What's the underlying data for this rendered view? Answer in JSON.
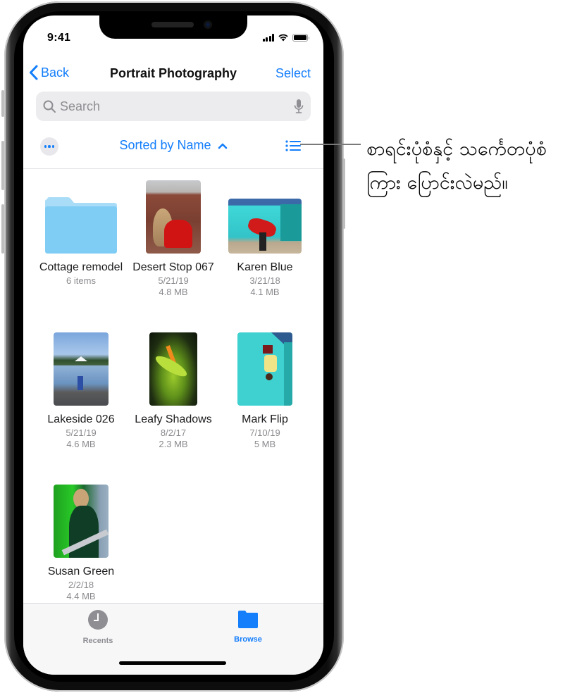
{
  "status_bar": {
    "time": "9:41"
  },
  "nav": {
    "back_label": "Back",
    "title": "Portrait Photography",
    "select_label": "Select"
  },
  "search": {
    "placeholder": "Search"
  },
  "sort_bar": {
    "sort_label": "Sorted by Name"
  },
  "items": [
    {
      "name": "Cottage remodel",
      "meta1": "6 items",
      "meta2": "",
      "kind": "folder"
    },
    {
      "name": "Desert Stop 067",
      "meta1": "5/21/19",
      "meta2": "4.8 MB",
      "kind": "photo"
    },
    {
      "name": "Karen Blue",
      "meta1": "3/21/18",
      "meta2": "4.1 MB",
      "kind": "photo"
    },
    {
      "name": "Lakeside 026",
      "meta1": "5/21/19",
      "meta2": "4.6 MB",
      "kind": "photo"
    },
    {
      "name": "Leafy Shadows",
      "meta1": "8/2/17",
      "meta2": "2.3 MB",
      "kind": "photo"
    },
    {
      "name": "Mark Flip",
      "meta1": "7/10/19",
      "meta2": "5 MB",
      "kind": "photo"
    },
    {
      "name": "Susan Green",
      "meta1": "2/2/18",
      "meta2": "4.4 MB",
      "kind": "photo"
    }
  ],
  "tabbar": {
    "tabs": [
      {
        "label": "Recents",
        "icon": "clock-icon",
        "active": false
      },
      {
        "label": "Browse",
        "icon": "folder-icon",
        "active": true
      }
    ]
  },
  "callout": {
    "text": "စာရင်းပုံစံနှင့် သင်္ကေတပုံစံကြား ပြောင်းလဲမည်။"
  },
  "colors": {
    "accent": "#147efb",
    "folder": "#7fcdf5",
    "secondary_text": "#8a8a8e",
    "inactive_tab": "#8e8e93"
  }
}
